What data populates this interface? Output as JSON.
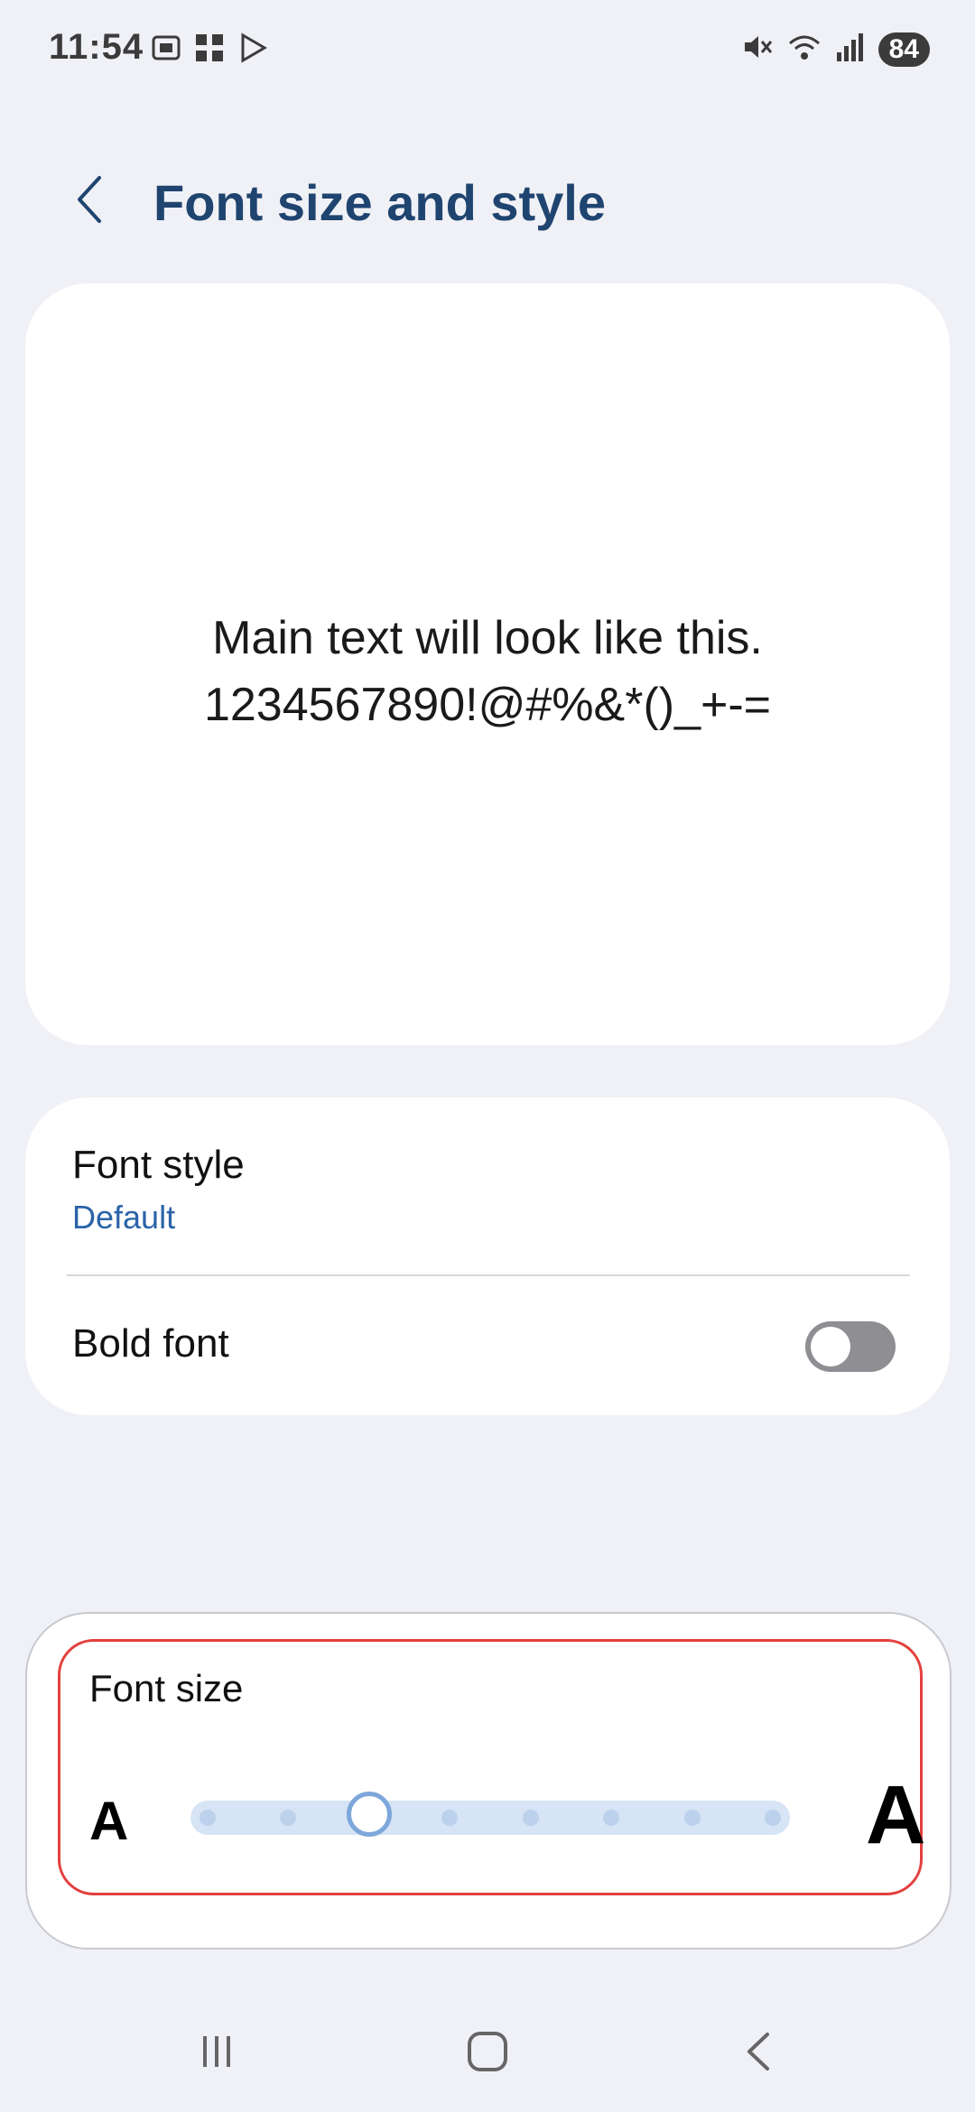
{
  "status_bar": {
    "time": "11:54",
    "battery": "84",
    "icons_left": [
      "screenshot-icon",
      "qr-grid-icon",
      "play-store-icon"
    ],
    "icons_right": [
      "mute-icon",
      "wifi-icon",
      "signal-icon"
    ]
  },
  "header": {
    "title": "Font size and style",
    "back_icon": "chevron-left-icon"
  },
  "preview": {
    "line1": "Main text will look like this.",
    "line2": "1234567890!@#%&*()_+-="
  },
  "settings": {
    "font_style": {
      "label": "Font style",
      "value": "Default"
    },
    "bold_font": {
      "label": "Bold font",
      "enabled": false
    }
  },
  "font_size": {
    "label": "Font size",
    "small_glyph": "A",
    "large_glyph": "A",
    "steps": 8,
    "selected_step": 3
  },
  "colors": {
    "title": "#1f4470",
    "accent": "#2b63a8",
    "highlight_border": "#e2403e",
    "background": "#f0f1f6"
  },
  "nav_bar": [
    "recents-icon",
    "home-icon",
    "back-icon"
  ]
}
